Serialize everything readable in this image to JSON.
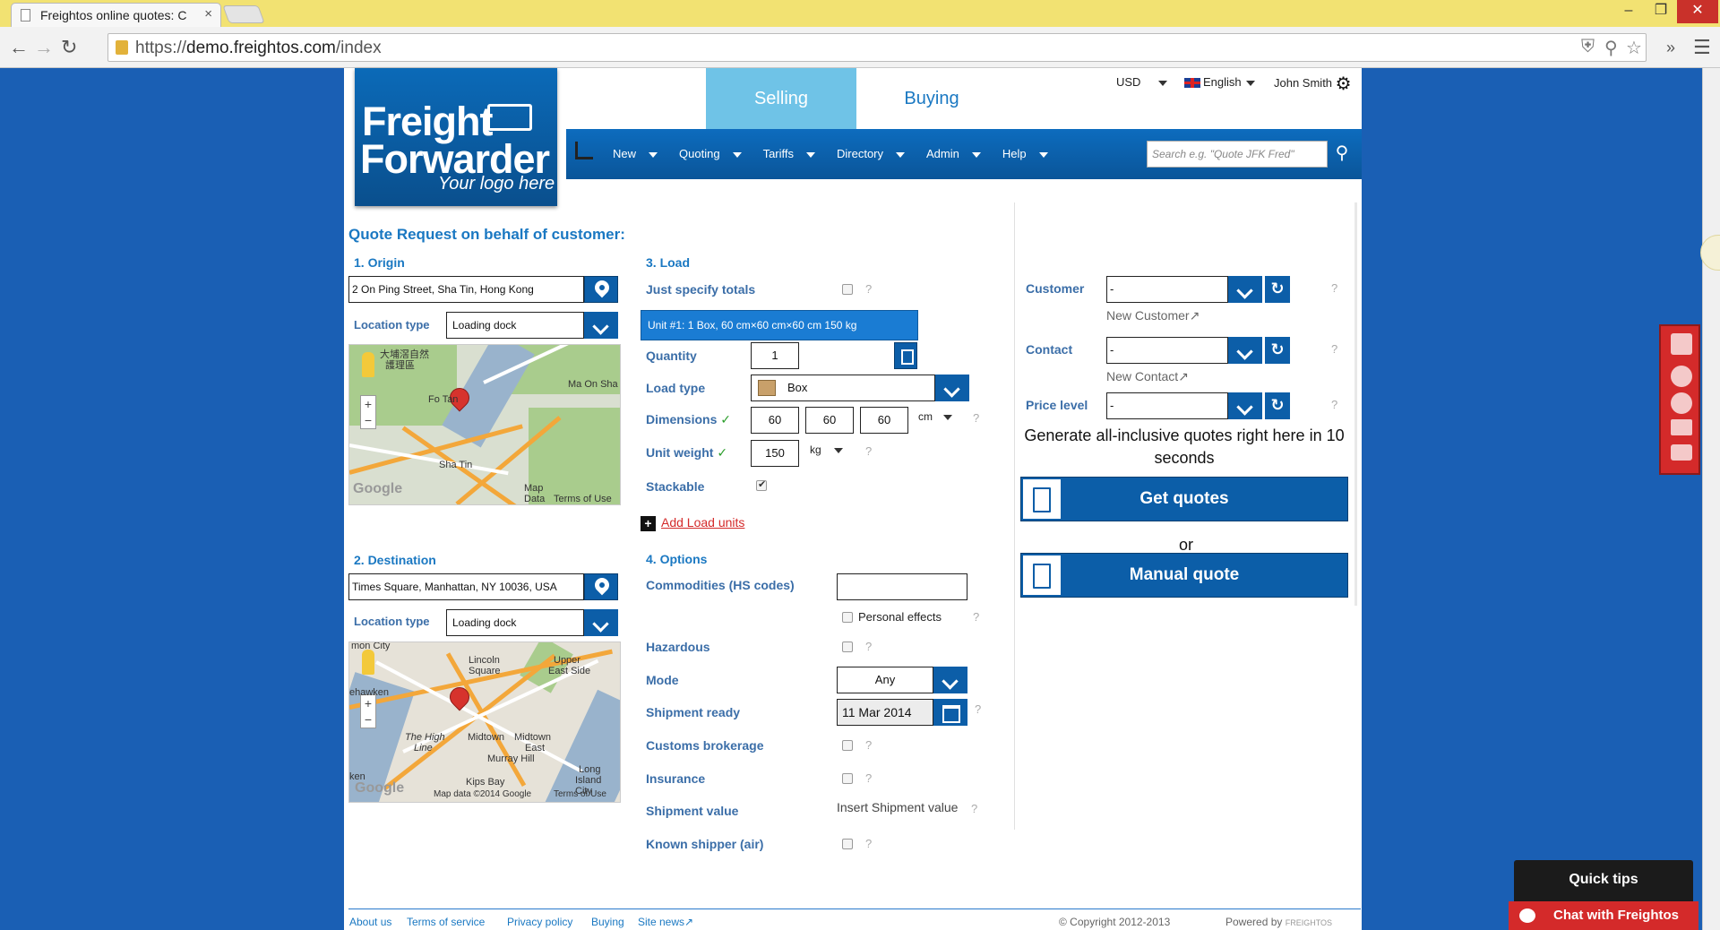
{
  "browser": {
    "tab_title": "Freightos online quotes: C",
    "tab_close": "×",
    "url_prefix": "https://",
    "url_host": "demo.freightos.com",
    "url_path": "/index"
  },
  "logo": {
    "line1": "Freight",
    "line2": "Forwarder",
    "line3": "Your logo here"
  },
  "mode_tabs": {
    "selling": "Selling",
    "buying": "Buying"
  },
  "top_right": {
    "currency": "USD",
    "language": "English",
    "user": "John Smith"
  },
  "nav": {
    "items": [
      "New",
      "Quoting",
      "Tariffs",
      "Directory",
      "Admin",
      "Help"
    ],
    "search_placeholder": "Search e.g. \"Quote JFK Fred\""
  },
  "heading": "Quote Request on behalf of customer:",
  "origin": {
    "title": "1. Origin",
    "address": "2 On Ping Street, Sha Tin, Hong Kong",
    "location_label": "Location type",
    "location_value": "Loading dock",
    "map_labels": [
      "大埔滘自然",
      "護理區",
      "Fo Tan",
      "Ma On Sha",
      "Sha Tin",
      "Map",
      "Data",
      "Terms of Use",
      "Google"
    ]
  },
  "destination": {
    "title": "2. Destination",
    "address": "Times Square, Manhattan, NY 10036, USA",
    "location_label": "Location type",
    "location_value": "Loading dock",
    "map_labels": [
      "mon City",
      "Lincoln",
      "Square",
      "Upper",
      "East Side",
      "ehawken",
      "The High",
      "Line",
      "Midtown",
      "Midtown",
      "East",
      "Murray Hill",
      "Kips Bay",
      "Long",
      "Island City",
      "ken",
      "Google",
      "Map data ©2014 Google",
      "Terms of Use"
    ]
  },
  "load": {
    "title": "3. Load",
    "just_specify": "Just specify totals",
    "unit_bar": "Unit #1: 1 Box, 60 cm×60 cm×60 cm 150 kg",
    "quantity_label": "Quantity",
    "quantity": "1",
    "load_type_label": "Load type",
    "load_type": "Box",
    "dimensions_label": "Dimensions",
    "dims": [
      "60",
      "60",
      "60"
    ],
    "dim_unit": "cm",
    "weight_label": "Unit weight",
    "weight": "150",
    "weight_unit": "kg",
    "stackable_label": "Stackable",
    "add_units": "Add Load units",
    "check": "✓"
  },
  "options": {
    "title": "4. Options",
    "commodities_label": "Commodities (HS codes)",
    "personal_effects": "Personal effects",
    "hazardous_label": "Hazardous",
    "mode_label": "Mode",
    "mode_value": "Any",
    "shipment_ready_label": "Shipment ready",
    "shipment_ready": "11 Mar 2014",
    "customs_label": "Customs brokerage",
    "insurance_label": "Insurance",
    "value_label": "Shipment value",
    "value_placeholder": "Insert Shipment value",
    "known_shipper_label": "Known shipper (air)"
  },
  "customer": {
    "customer_label": "Customer",
    "customer_value": "-",
    "new_customer": "New Customer↗",
    "contact_label": "Contact",
    "contact_value": "-",
    "new_contact": "New Contact↗",
    "price_label": "Price level",
    "price_value": "-",
    "generate_text": "Generate all-inclusive quotes right here in 10 seconds",
    "get_quotes": "Get quotes",
    "or": "or",
    "manual_quote": "Manual quote"
  },
  "footer": {
    "links": [
      "About us",
      "Terms of service",
      "Privacy policy",
      "Buying",
      "Site news↗"
    ],
    "copyright": "© Copyright 2012-2013",
    "powered": "Powered by",
    "powered_brand": "FREIGHTOS"
  },
  "widgets": {
    "quick_tips": "Quick tips",
    "chat": "Chat with Freightos"
  },
  "q": "?"
}
